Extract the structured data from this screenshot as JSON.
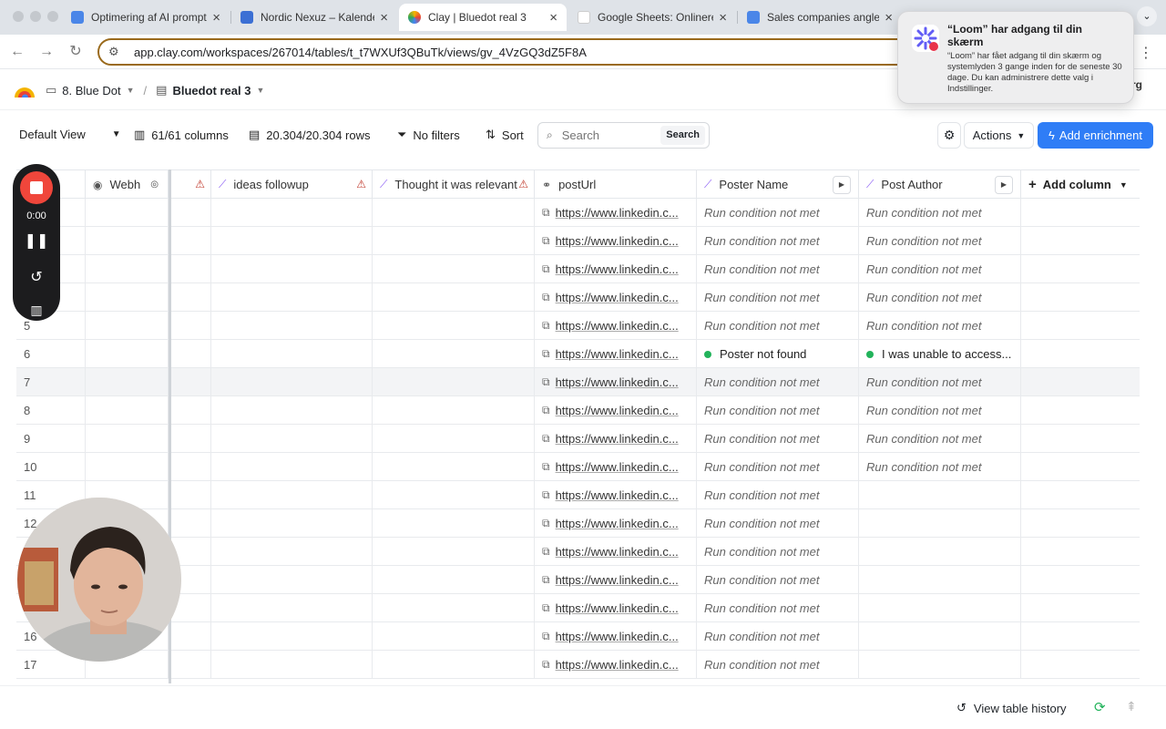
{
  "browser": {
    "tabs": [
      {
        "title": "Optimering af AI prompt",
        "color": "#4a86e8"
      },
      {
        "title": "Nordic Nexuz – Kalender",
        "color": "#3b6fd4"
      },
      {
        "title": "Clay | Bluedot real 3",
        "color": "#f4b400"
      },
      {
        "title": "Google Sheets: Onlinere",
        "color": "#34a853"
      },
      {
        "title": "Sales companies angles",
        "color": "#4a86e8"
      }
    ],
    "url": "app.clay.com/workspaces/267014/tables/t_t7WXUf3QBuTk/views/gv_4VzGQ3dZ5F8A"
  },
  "app": {
    "breadcrumb_folder": "8. Blue Dot",
    "breadcrumb_sep": "/",
    "breadcrumb_table": "Bluedot real 3",
    "head_right_fragment": "rg"
  },
  "toolbar": {
    "view": "Default View",
    "columns": "61/61 columns",
    "rows": "20.304/20.304 rows",
    "filters": "No filters",
    "sort": "Sort",
    "search_placeholder": "Search",
    "search_button": "Search",
    "actions": "Actions",
    "add_enrichment": "Add enrichment"
  },
  "columns": {
    "webhook": "Webh",
    "ideas": "ideas followup",
    "thought": "Thought it was relevant",
    "posturl": "postUrl",
    "poster": "Poster Name",
    "author": "Post Author",
    "add": "Add column"
  },
  "cell_texts": {
    "url": "https://www.linkedin.c...",
    "not_met": "Run condition not met",
    "poster_not_found": "Poster not found",
    "unable": "I was unable to access..."
  },
  "rows": [
    {
      "n": "",
      "poster": "not_met",
      "author": "not_met"
    },
    {
      "n": "",
      "poster": "not_met",
      "author": "not_met"
    },
    {
      "n": "",
      "poster": "not_met",
      "author": "not_met"
    },
    {
      "n": "",
      "poster": "not_met",
      "author": "not_met"
    },
    {
      "n": "5",
      "poster": "not_met",
      "author": "not_met"
    },
    {
      "n": "6",
      "poster": "found",
      "author": "unable"
    },
    {
      "n": "7",
      "poster": "not_met",
      "author": "not_met",
      "highlight": true
    },
    {
      "n": "8",
      "poster": "not_met",
      "author": "not_met"
    },
    {
      "n": "9",
      "poster": "not_met",
      "author": "not_met"
    },
    {
      "n": "10",
      "poster": "not_met",
      "author": "not_met"
    },
    {
      "n": "11",
      "poster": "not_met",
      "author": ""
    },
    {
      "n": "12",
      "poster": "not_met",
      "author": ""
    },
    {
      "n": "",
      "poster": "not_met",
      "author": ""
    },
    {
      "n": "",
      "poster": "not_met",
      "author": ""
    },
    {
      "n": "",
      "poster": "not_met",
      "author": ""
    },
    {
      "n": "16",
      "poster": "not_met",
      "author": ""
    },
    {
      "n": "17",
      "poster": "not_met",
      "author": ""
    }
  ],
  "footer": {
    "history": "View table history"
  },
  "loom": {
    "timer": "0:00",
    "notif_title": "“Loom” har adgang til din skærm",
    "notif_body": "“Loom” har fået adgang til din skærm og systemlyden 3 gange inden for de seneste 30 dage. Du kan administrere dette valg i Indstillinger."
  },
  "colors": {
    "accent": "#2f7df6",
    "ai_icon": "#8a5cf5",
    "success": "#22b35b",
    "loom_red": "#f0463b"
  }
}
